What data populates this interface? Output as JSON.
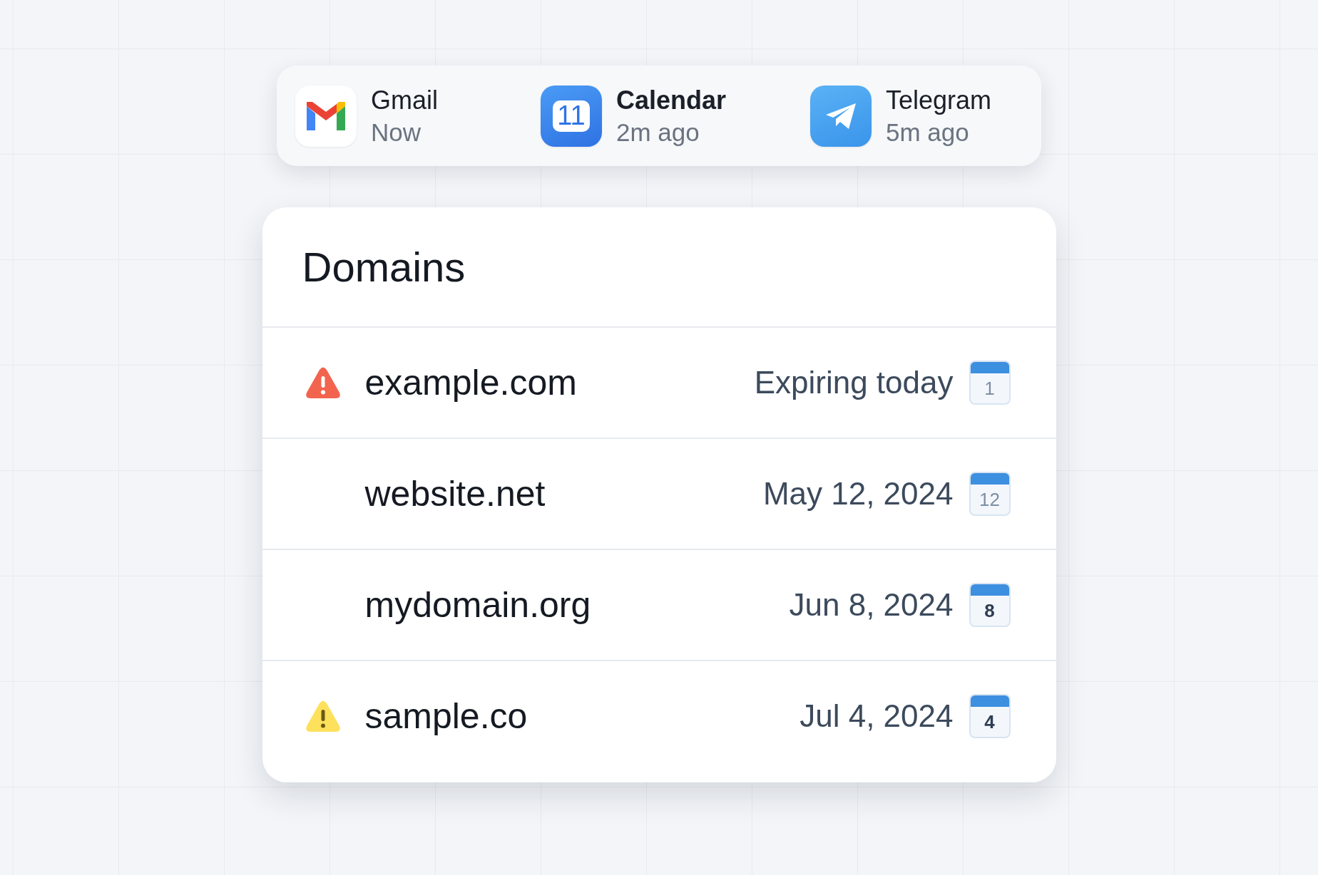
{
  "notifications": [
    {
      "kind": "gmail",
      "app": "Gmail",
      "time": "Now",
      "bold": false
    },
    {
      "kind": "calendar",
      "app": "Calendar",
      "time": "2m ago",
      "bold": true,
      "badge": "11"
    },
    {
      "kind": "telegram",
      "app": "Telegram",
      "time": "5m ago",
      "bold": false
    }
  ],
  "domains_card": {
    "title": "Domains",
    "rows": [
      {
        "domain": "example.com",
        "kind": "critical",
        "date": "Expiring today",
        "day": "1",
        "muted": true
      },
      {
        "domain": "website.net",
        "kind": "plain",
        "date": "May 12, 2024",
        "day": "12",
        "muted": true
      },
      {
        "domain": "mydomain.org",
        "kind": "plain",
        "date": "Jun 8, 2024",
        "day": "8",
        "muted": false
      },
      {
        "domain": "sample.co",
        "kind": "warning",
        "date": "Jul 4, 2024",
        "day": "4",
        "muted": false
      }
    ]
  }
}
